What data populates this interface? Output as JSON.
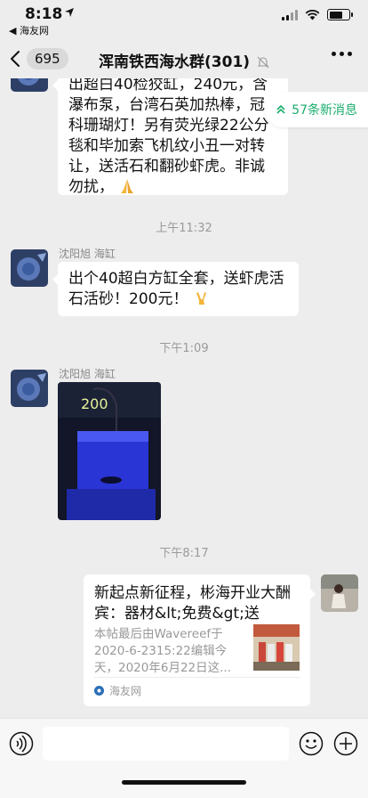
{
  "status_bar": {
    "time": "8:18",
    "back_app": "◀ 海友网"
  },
  "nav": {
    "unread_count": "695",
    "title": "浑南铁西海水群(301)"
  },
  "banner": {
    "new_messages": "57条新消息"
  },
  "messages": {
    "first_bubble_text": "出超白40检狡缸，240元，含瀑布泵，台湾石英加热棒，冠科珊瑚灯！另有荧光绿22公分毯和毕加索飞机纹小丑一对转让，送活石和翻砂虾虎。非诚勿扰，",
    "timestamp_1": "上午11:32",
    "sender_1": "沈阳旭 海缸",
    "second_bubble_text": "出个40超白方缸全套，送虾虎活石活砂！200元！",
    "timestamp_2": "下午1:09",
    "sender_2": "沈阳旭 海缸",
    "photo_label": "200",
    "timestamp_3": "下午8:17"
  },
  "link_card": {
    "title": "新起点新征程，彬海开业大酬宾：器材&lt;免费&gt;送",
    "description": "本帖最后由Wavereef于2020-6-2315:22编辑今天，2020年6月22日这...",
    "source": "海友网"
  },
  "colors": {
    "accent_green": "#1aad6c",
    "background": "#ededed"
  },
  "icons": {
    "back": "chevron-left-icon",
    "mute": "bell-off-icon",
    "more": "more-icon",
    "voice": "voice-icon",
    "emoji": "emoji-icon",
    "plus": "plus-icon"
  }
}
